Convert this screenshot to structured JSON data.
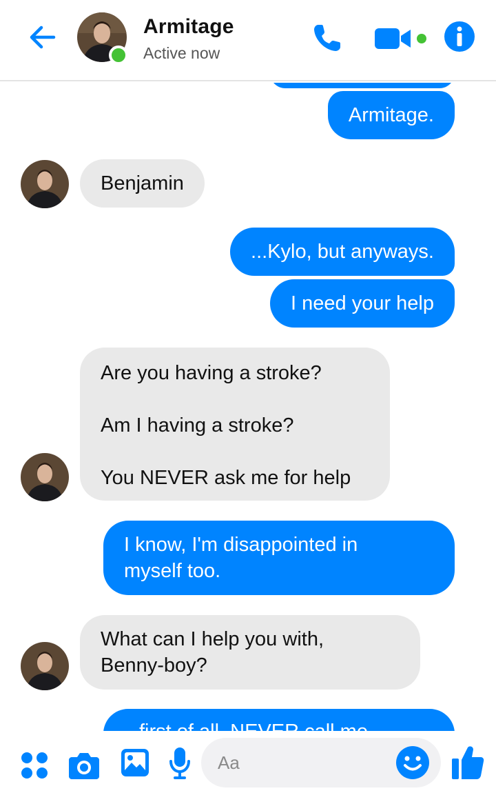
{
  "header": {
    "contact_name": "Armitage",
    "status": "Active now"
  },
  "colors": {
    "accent": "#0084ff",
    "incoming_bubble": "#e9e9e9",
    "active_dot": "#44c235"
  },
  "icons": {
    "back": "back-arrow-icon",
    "call": "phone-icon",
    "video": "video-camera-icon",
    "info": "info-icon",
    "more": "four-dots-icon",
    "camera": "camera-icon",
    "gallery": "image-icon",
    "mic": "microphone-icon",
    "emoji": "smiley-icon",
    "like": "thumbs-up-icon"
  },
  "messages": [
    {
      "from": "me",
      "text": "Armitage."
    },
    {
      "from": "them",
      "text": "Benjamin"
    },
    {
      "from": "me",
      "text": "...Kylo, but anyways."
    },
    {
      "from": "me",
      "text": "I need your help"
    },
    {
      "from": "them",
      "text": "Are you having a stroke?\n\nAm I having a stroke?\n\nYou NEVER ask me for help"
    },
    {
      "from": "me",
      "text": "I know, I'm disappointed in\nmyself too."
    },
    {
      "from": "them",
      "text": "What can I help you with,\nBenny-boy?"
    },
    {
      "from": "me",
      "text": "first of all, NEVER call me"
    }
  ],
  "composer": {
    "placeholder": "Aa"
  }
}
